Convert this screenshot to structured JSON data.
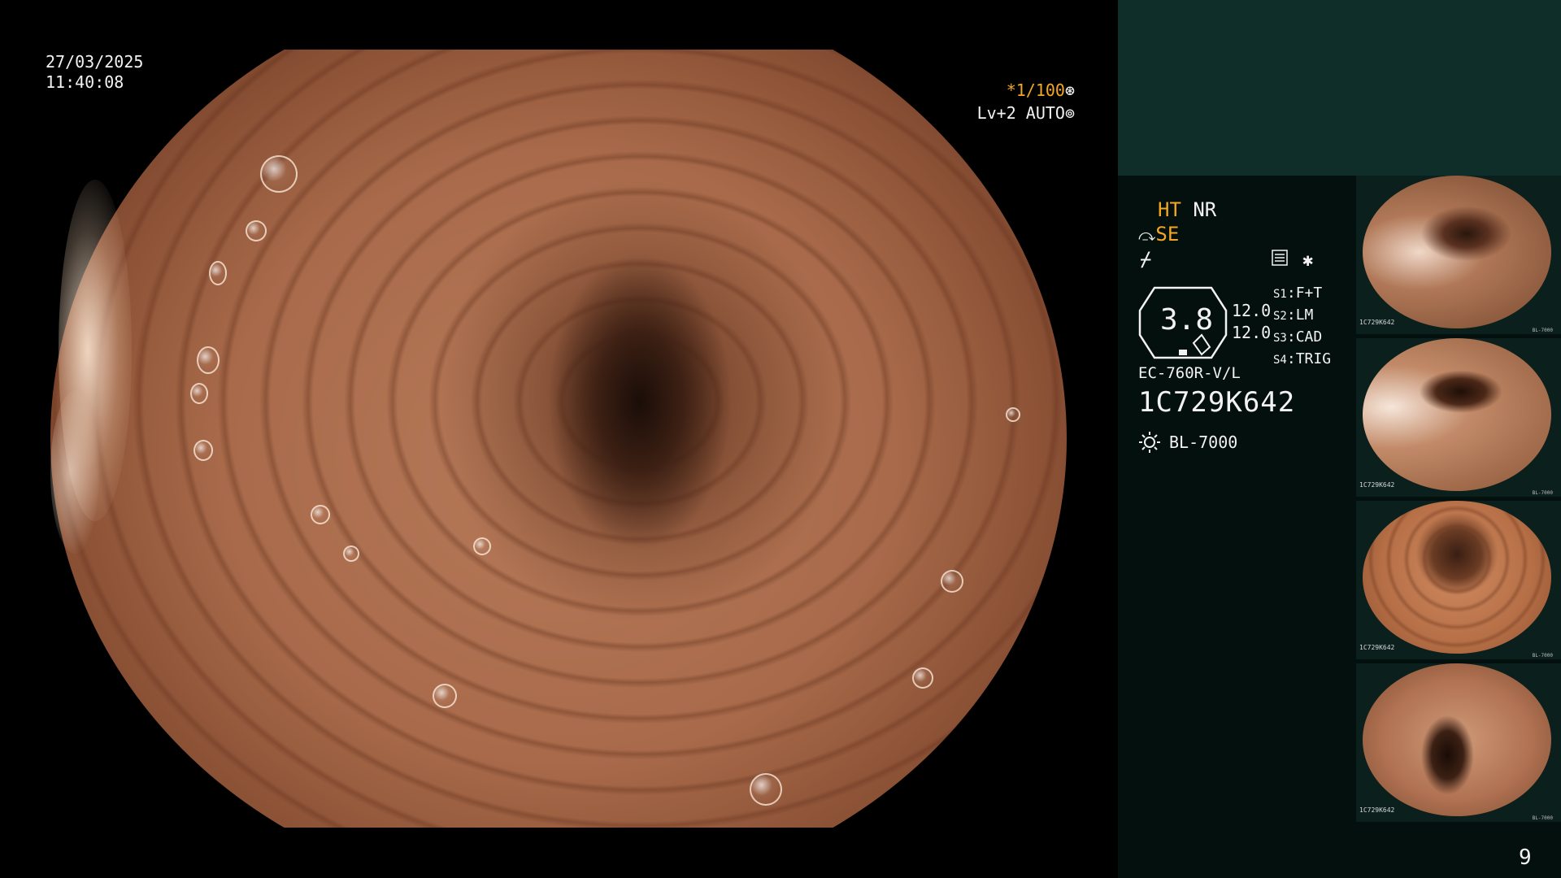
{
  "overlay": {
    "date": "27/03/2025",
    "time": "11:40:08",
    "shutter": "*1/100",
    "level_auto": "Lv+2 AUTO"
  },
  "panel": {
    "ht": "HT",
    "nr": "NR",
    "se": "SE",
    "octagon_value": "3.8",
    "value_1": "12.0",
    "value_2": "12.0",
    "s_settings": [
      {
        "key": "S1",
        "value": "F+T"
      },
      {
        "key": "S2",
        "value": "LM"
      },
      {
        "key": "S3",
        "value": "CAD"
      },
      {
        "key": "S4",
        "value": "TRIG"
      }
    ],
    "model": "EC-760R-V/L",
    "serial": "1C729K642",
    "light_source": "BL-7000",
    "page_number": "9"
  },
  "thumbnails": [
    {
      "serial": "1C729K642",
      "light": "BL-7000"
    },
    {
      "serial": "1C729K642",
      "light": "BL-7000"
    },
    {
      "serial": "1C729K642",
      "light": "BL-7000"
    },
    {
      "serial": "1C729K642",
      "light": "BL-7000"
    }
  ],
  "icons": [
    "shutter-icon",
    "auto-iris-icon",
    "se-icon",
    "enhance-slash-icon",
    "menu-icon",
    "star-icon",
    "light-source-icon",
    "scope-icon"
  ],
  "colors": {
    "accent": "#f5a623",
    "panel_top": "#0f2e2a",
    "panel": "#04100e",
    "text": "#f2f2f2"
  }
}
